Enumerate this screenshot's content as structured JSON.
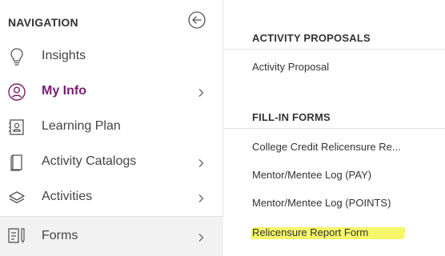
{
  "navigation": {
    "title": "NAVIGATION",
    "items": [
      {
        "label": "Insights",
        "icon": "lightbulb-icon",
        "has_submenu": false,
        "active": false
      },
      {
        "label": "My Info",
        "icon": "user-circle-icon",
        "has_submenu": true,
        "active": true
      },
      {
        "label": "Learning Plan",
        "icon": "contact-card-icon",
        "has_submenu": false,
        "active": false
      },
      {
        "label": "Activity Catalogs",
        "icon": "book-icon",
        "has_submenu": true,
        "active": false
      },
      {
        "label": "Activities",
        "icon": "layers-icon",
        "has_submenu": true,
        "active": false
      },
      {
        "label": "Forms",
        "icon": "form-icon",
        "has_submenu": true,
        "active": false
      }
    ]
  },
  "panel": {
    "sections": [
      {
        "title": "ACTIVITY PROPOSALS",
        "links": [
          "Activity Proposal"
        ]
      },
      {
        "title": "FILL-IN FORMS",
        "links": [
          "College Credit Relicensure Re...",
          "Mentor/Mentee Log (PAY)",
          "Mentor/Mentee Log (POINTS)",
          "Relicensure Report Form"
        ]
      }
    ]
  },
  "colors": {
    "active": "#7a1f6e",
    "highlight": "#f6f66a",
    "text": "#333333"
  }
}
